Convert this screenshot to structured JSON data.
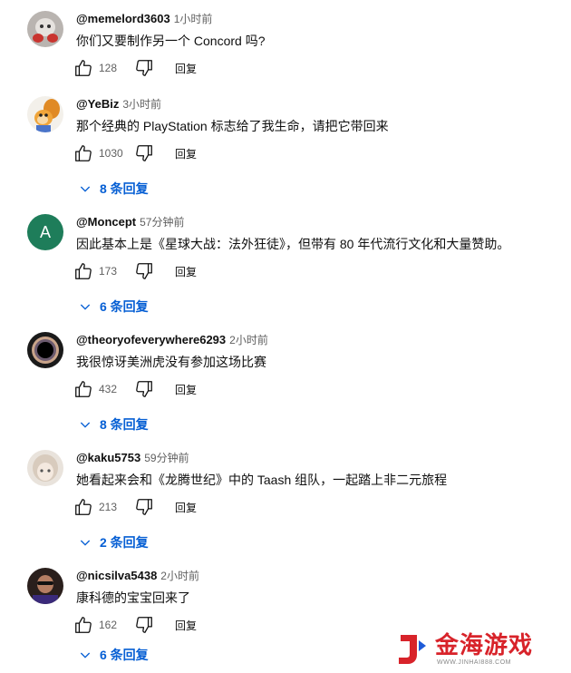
{
  "ui": {
    "reply_label": "回复"
  },
  "comments": [
    {
      "handle": "@memelord3603",
      "time": "1小时前",
      "text": "你们又要制作另一个 Concord 吗?",
      "likes": "128",
      "replies": ""
    },
    {
      "handle": "@YeBiz",
      "time": "3小时前",
      "text": "那个经典的 PlayStation 标志给了我生命，请把它带回来",
      "likes": "1030",
      "replies": "8 条回复"
    },
    {
      "handle": "@Moncept",
      "time": "57分钟前",
      "text": "因此基本上是《星球大战：法外狂徒》，但带有 80 年代流行文化和大量赞助。",
      "likes": "173",
      "replies": "6 条回复",
      "avatar_letter": "A"
    },
    {
      "handle": "@theoryofeverywhere6293",
      "time": "2小时前",
      "text": "我很惊讶美洲虎没有参加这场比赛",
      "likes": "432",
      "replies": "8 条回复"
    },
    {
      "handle": "@kaku5753",
      "time": "59分钟前",
      "text": "她看起来会和《龙腾世纪》中的 Taash 组队，一起踏上非二元旅程",
      "likes": "213",
      "replies": "2 条回复"
    },
    {
      "handle": "@nicsilva5438",
      "time": "2小时前",
      "text": "康科德的宝宝回来了",
      "likes": "162",
      "replies": "6 条回复"
    }
  ],
  "watermark": {
    "text": "金海游戏",
    "sub": "WWW.JINHAI888.COM"
  },
  "colors": {
    "link": "#065fd4",
    "muted": "#606060",
    "avatar_green": "#1e7d5a",
    "watermark_red": "#d8232a"
  }
}
